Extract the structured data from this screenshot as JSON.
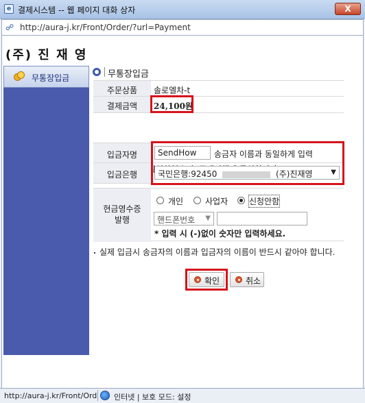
{
  "window": {
    "title": "결제시스템 -- 웹 페이지 대화 상자",
    "close_label": "X",
    "url": "http://aura-j.kr/Front/Order/?url=Payment"
  },
  "company": "(주) 진 재 영",
  "sidebar": {
    "items": [
      {
        "label": "무통장입금",
        "icon": "coins-icon"
      }
    ]
  },
  "section_title": "무통장입금",
  "order": {
    "product_label": "주문상품",
    "product_value": "솔로엘차-t",
    "amount_label": "결제금액",
    "amount_value": "24,100원"
  },
  "agree": {
    "checked": true,
    "text": "결제정보를 확인하였으며, 구매진행에 동의합니다."
  },
  "depositor": {
    "label": "입금자명",
    "value": "SendHow",
    "hint": "송금자 이름과 동일하게 입력"
  },
  "bank": {
    "label": "입금은행",
    "prefix": "국민은행:92450",
    "suffix": "(주)진재영"
  },
  "receipt": {
    "label_line1": "현금영수증",
    "label_line2": "발행",
    "options": [
      "개인",
      "사업자",
      "신청안함"
    ],
    "selected": "신청안함",
    "type_select": "핸드폰번호",
    "note": "* 입력 시 (-)없이 숫자만 입력하세요."
  },
  "notice": "실제 입금시 송금자의 이름과 입금자의 이름이 반드시 같아야 합니다.",
  "buttons": {
    "confirm": "확인",
    "cancel": "취소"
  },
  "statusbar": {
    "url": "http://aura-j.kr/Front/Ord",
    "zone": "인터넷 | 보호 모드: 설정"
  },
  "colors": {
    "highlight": "#d6121c",
    "sidebar": "#4a5bad",
    "accent": "#3b5ab0"
  }
}
